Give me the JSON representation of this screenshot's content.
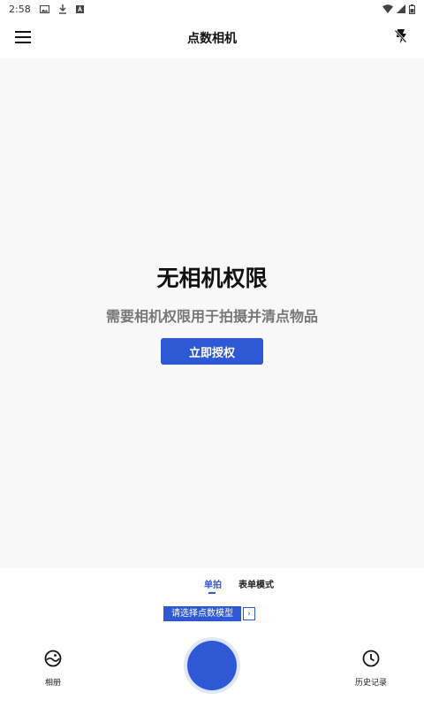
{
  "status_bar": {
    "time": "2:58"
  },
  "app_bar": {
    "title": "点数相机"
  },
  "permission": {
    "title": "无相机权限",
    "description": "需要相机权限用于拍摄并清点物品",
    "grant_button": "立即授权"
  },
  "modes": {
    "single": "单拍",
    "form": "表单模式"
  },
  "model_selector": {
    "label": "请选择点数模型",
    "arrow": "›"
  },
  "bottom_nav": {
    "album": "相册",
    "history": "历史记录"
  },
  "colors": {
    "accent": "#2f58d4",
    "preview_bg": "#f8f8f8",
    "shutter_ring": "#dfe6fa"
  },
  "icons": {
    "menu": "menu-icon",
    "flash_off": "flash-off-icon",
    "album": "album-icon",
    "history": "clock-icon",
    "photo": "image-icon",
    "download": "download-icon",
    "notification": "a-icon",
    "wifi": "wifi-icon",
    "signal": "signal-icon",
    "battery": "battery-icon"
  }
}
